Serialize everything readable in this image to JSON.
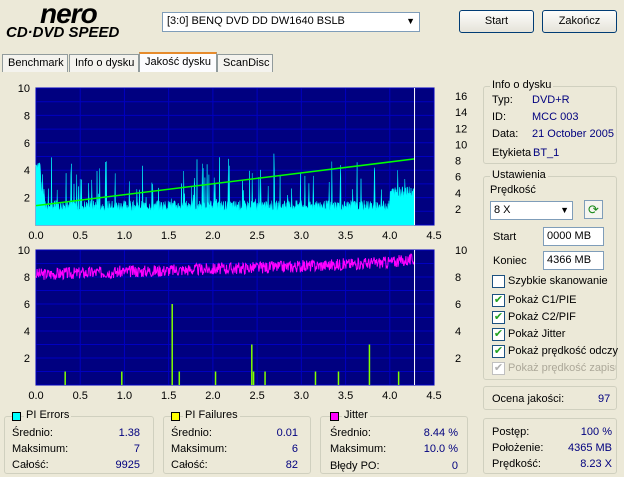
{
  "logo": {
    "brand": "nero",
    "product": "CD·DVD SPEED"
  },
  "drive": {
    "selected": "[3:0]  BENQ DVD DD DW1640 BSLB"
  },
  "buttons": {
    "start": "Start",
    "quit": "Zakończ"
  },
  "tabs": [
    {
      "label": "Benchmark"
    },
    {
      "label": "Info o dysku"
    },
    {
      "label": "Jakość dysku",
      "active": true
    },
    {
      "label": "ScanDisc"
    }
  ],
  "disc_info": {
    "title": "Info o dysku",
    "type_label": "Typ:",
    "type_value": "DVD+R",
    "id_label": "ID:",
    "id_value": "MCC 003",
    "date_label": "Data:",
    "date_value": "21 October 2005",
    "tag_label": "Etykieta",
    "tag_value": "BT_1"
  },
  "settings": {
    "title": "Ustawienia",
    "speed_label": "Prędkość",
    "speed_value": "8 X",
    "start_label": "Start",
    "start_value": "0000 MB",
    "end_label": "Koniec",
    "end_value": "4366 MB",
    "quick_scan": "Szybkie skanowanie",
    "show_c1": "Pokaż C1/PIE",
    "show_c2": "Pokaż C2/PIF",
    "show_jitter": "Pokaż Jitter",
    "show_read_speed": "Pokaż prędkość odczy",
    "show_write_speed": "Pokaż prędkość zapisu"
  },
  "quality": {
    "label": "Ocena jakości:",
    "value": "97"
  },
  "progress": {
    "progress_label": "Postęp:",
    "progress_value": "100 %",
    "position_label": "Położenie:",
    "position_value": "4365 MB",
    "speed_label": "Prędkość:",
    "speed_value": "8.23 X"
  },
  "pi_errors": {
    "title": "PI Errors",
    "avg_label": "Średnio:",
    "avg": "1.38",
    "max_label": "Maksimum:",
    "max": "7",
    "total_label": "Całość:",
    "total": "9925",
    "color": "#00ffff"
  },
  "pi_failures": {
    "title": "PI Failures",
    "avg_label": "Średnio:",
    "avg": "0.01",
    "max_label": "Maksimum:",
    "max": "6",
    "total_label": "Całość:",
    "total": "82",
    "color": "#ffff00"
  },
  "jitter": {
    "title": "Jitter",
    "avg_label": "Średnio:",
    "avg": "8.44 %",
    "max_label": "Maksimum:",
    "max": "10.0 %",
    "po_label": "Błędy PO:",
    "po": "0",
    "color": "#ff00ff"
  },
  "colors": {
    "plot_bg": "#000080",
    "grid": "#0000c0",
    "pie": "#00ffff",
    "speed": "#00ff00",
    "pif": "#80ff00",
    "jitter": "#ff00ff"
  },
  "chart_data": [
    {
      "type": "area",
      "series": [
        {
          "name": "PI Errors",
          "x": [
            0.0,
            0.05,
            0.1,
            0.2,
            0.5,
            1.0,
            1.5,
            2.0,
            2.5,
            3.0,
            3.5,
            4.0,
            4.28
          ],
          "values": [
            4,
            2,
            1,
            1,
            1,
            1,
            1,
            1,
            1,
            1,
            1,
            2,
            1
          ]
        },
        {
          "name": "Read speed",
          "x": [
            0.0,
            4.28
          ],
          "values": [
            2.4,
            8.2
          ]
        }
      ],
      "x_ticks": [
        "0.0",
        "0.5",
        "1.0",
        "1.5",
        "2.0",
        "2.5",
        "3.0",
        "3.5",
        "4.0",
        "4.5"
      ],
      "y_ticks_left": [
        "2",
        "4",
        "6",
        "8",
        "10"
      ],
      "y_ticks_right": [
        "2",
        "4",
        "6",
        "8",
        "10",
        "12",
        "14",
        "16"
      ],
      "xlim": [
        0,
        4.5
      ],
      "ylim_left": [
        0,
        10
      ],
      "ylim_right": [
        0,
        17
      ]
    },
    {
      "type": "line",
      "series": [
        {
          "name": "Jitter",
          "x": [
            0.0,
            1.0,
            2.0,
            3.0,
            4.0,
            4.28
          ],
          "values": [
            8.2,
            8.4,
            8.6,
            8.8,
            9.1,
            9.3
          ]
        },
        {
          "name": "PI Failures",
          "x": [
            0.33,
            0.97,
            1.54,
            1.62,
            2.03,
            2.44,
            2.46,
            2.59,
            3.16,
            3.42,
            3.77,
            4.1
          ],
          "values": [
            1,
            1,
            6,
            1,
            1,
            3,
            1,
            1,
            1,
            1,
            3,
            1
          ]
        }
      ],
      "x_ticks": [
        "0.0",
        "0.5",
        "1.0",
        "1.5",
        "2.0",
        "2.5",
        "3.0",
        "3.5",
        "4.0",
        "4.5"
      ],
      "y_ticks_left": [
        "2",
        "4",
        "6",
        "8",
        "10"
      ],
      "y_ticks_right": [
        "2",
        "4",
        "6",
        "8",
        "10"
      ],
      "xlim": [
        0,
        4.5
      ],
      "ylim_left": [
        0,
        10
      ],
      "ylim_right": [
        0,
        10
      ]
    }
  ]
}
